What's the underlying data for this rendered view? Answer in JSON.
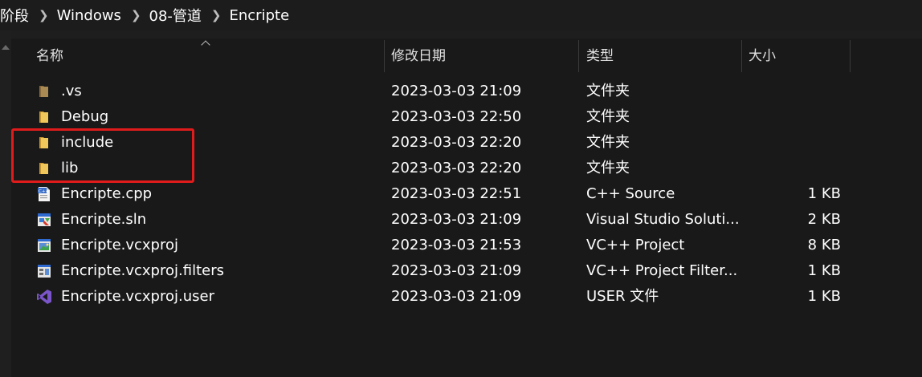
{
  "breadcrumb": [
    "阶段",
    "Windows",
    "08-管道",
    "Encripte"
  ],
  "header": {
    "name": "名称",
    "date": "修改日期",
    "type": "类型",
    "size": "大小"
  },
  "files": [
    {
      "name": ".vs",
      "date": "2023-03-03 21:09",
      "type": "文件夹",
      "size": "",
      "icon": "folder-dim-icon"
    },
    {
      "name": "Debug",
      "date": "2023-03-03 22:50",
      "type": "文件夹",
      "size": "",
      "icon": "folder-icon"
    },
    {
      "name": "include",
      "date": "2023-03-03 22:20",
      "type": "文件夹",
      "size": "",
      "icon": "folder-icon"
    },
    {
      "name": "lib",
      "date": "2023-03-03 22:20",
      "type": "文件夹",
      "size": "",
      "icon": "folder-icon"
    },
    {
      "name": "Encripte.cpp",
      "date": "2023-03-03 22:51",
      "type": "C++ Source",
      "size": "1 KB",
      "icon": "cpp-file-icon"
    },
    {
      "name": "Encripte.sln",
      "date": "2023-03-03 21:09",
      "type": "Visual Studio Soluti...",
      "size": "2 KB",
      "icon": "sln-file-icon"
    },
    {
      "name": "Encripte.vcxproj",
      "date": "2023-03-03 21:53",
      "type": "VC++ Project",
      "size": "8 KB",
      "icon": "vcxproj-file-icon"
    },
    {
      "name": "Encripte.vcxproj.filters",
      "date": "2023-03-03 21:09",
      "type": "VC++ Project Filter...",
      "size": "1 KB",
      "icon": "filters-file-icon"
    },
    {
      "name": "Encripte.vcxproj.user",
      "date": "2023-03-03 21:09",
      "type": "USER 文件",
      "size": "1 KB",
      "icon": "vs-user-file-icon"
    }
  ],
  "colors": {
    "background": "#191919",
    "highlight": "#e01b1b",
    "folder": "#e8b84a"
  }
}
